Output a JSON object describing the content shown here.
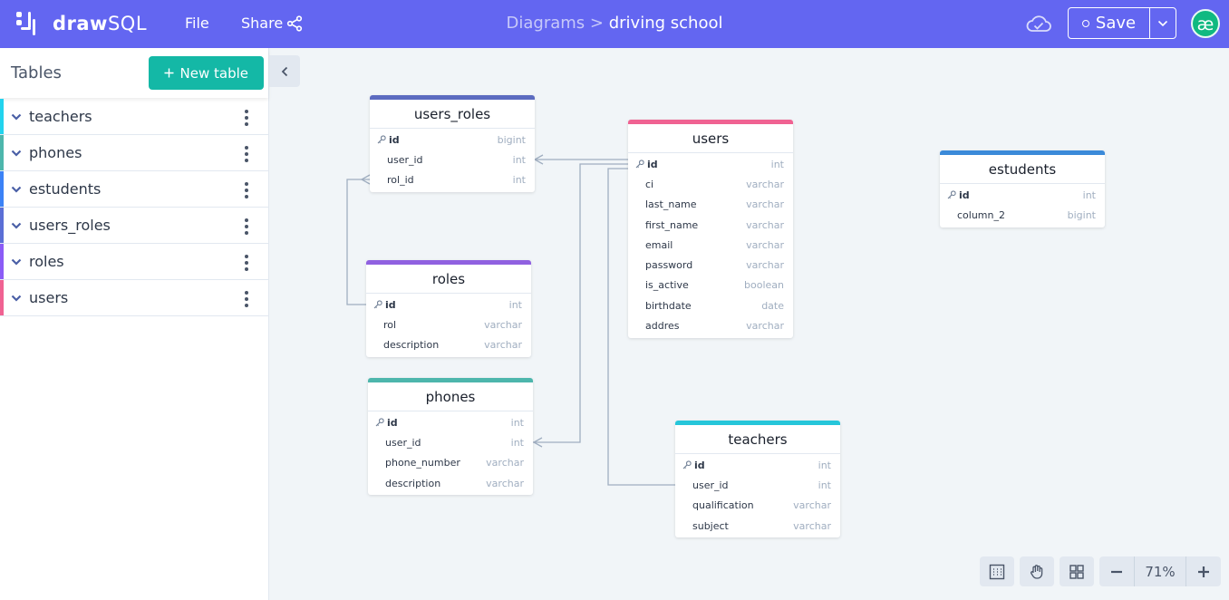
{
  "header": {
    "logo_bold": "draw",
    "logo_light": "SQL",
    "file_label": "File",
    "share_label": "Share",
    "breadcrumb_parent": "Diagrams >",
    "diagram_name": "driving school",
    "save_label": "Save",
    "avatar_text": "æ"
  },
  "sidebar": {
    "title": "Tables",
    "new_table_label": "New table",
    "items": [
      {
        "label": "teachers",
        "color": "#22d3ee"
      },
      {
        "label": "phones",
        "color": "#4db6ac"
      },
      {
        "label": "estudents",
        "color": "#3b82f6"
      },
      {
        "label": "users_roles",
        "color": "#5b6fd6"
      },
      {
        "label": "roles",
        "color": "#8b5cf6"
      },
      {
        "label": "users",
        "color": "#f06292"
      }
    ]
  },
  "tables": {
    "users_roles": {
      "name": "users_roles",
      "color": "#5c6bc0",
      "columns": [
        {
          "name": "id",
          "type": "bigint"
        },
        {
          "name": "user_id",
          "type": "int"
        },
        {
          "name": "rol_id",
          "type": "int"
        }
      ]
    },
    "users": {
      "name": "users",
      "color": "#f06292",
      "columns": [
        {
          "name": "id",
          "type": "int"
        },
        {
          "name": "ci",
          "type": "varchar"
        },
        {
          "name": "last_name",
          "type": "varchar"
        },
        {
          "name": "first_name",
          "type": "varchar"
        },
        {
          "name": "email",
          "type": "varchar"
        },
        {
          "name": "password",
          "type": "varchar"
        },
        {
          "name": "is_active",
          "type": "boolean"
        },
        {
          "name": "birthdate",
          "type": "date"
        },
        {
          "name": "addres",
          "type": "varchar"
        }
      ]
    },
    "estudents": {
      "name": "estudents",
      "color": "#3b8ad9",
      "columns": [
        {
          "name": "id",
          "type": "int"
        },
        {
          "name": "column_2",
          "type": "bigint"
        }
      ]
    },
    "roles": {
      "name": "roles",
      "color": "#9061e0",
      "columns": [
        {
          "name": "id",
          "type": "int"
        },
        {
          "name": "rol",
          "type": "varchar"
        },
        {
          "name": "description",
          "type": "varchar"
        }
      ]
    },
    "phones": {
      "name": "phones",
      "color": "#4db6ac",
      "columns": [
        {
          "name": "id",
          "type": "int"
        },
        {
          "name": "user_id",
          "type": "int"
        },
        {
          "name": "phone_number",
          "type": "varchar"
        },
        {
          "name": "description",
          "type": "varchar"
        }
      ]
    },
    "teachers": {
      "name": "teachers",
      "color": "#26c6da",
      "columns": [
        {
          "name": "id",
          "type": "int"
        },
        {
          "name": "user_id",
          "type": "int"
        },
        {
          "name": "qualification",
          "type": "varchar"
        },
        {
          "name": "subject",
          "type": "varchar"
        }
      ]
    }
  },
  "toolbar": {
    "zoom": "71%"
  }
}
